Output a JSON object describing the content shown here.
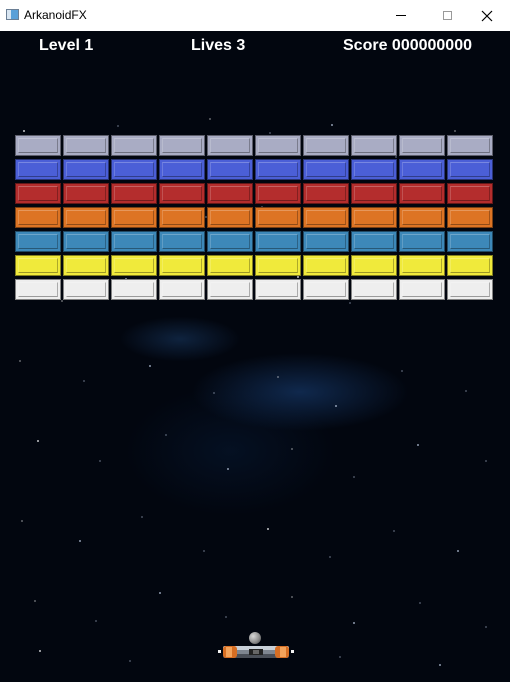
{
  "window": {
    "title": "ArkanoidFX",
    "min_icon": "minimize-icon",
    "max_icon": "maximize-icon",
    "close_icon": "close-icon"
  },
  "hud": {
    "level": "Level 1",
    "lives": "Lives 3",
    "score": "Score 000000000"
  },
  "bricks": {
    "columns": 10,
    "rows": [
      {
        "name": "silver",
        "color": "#a9acc4"
      },
      {
        "name": "blue",
        "color": "#4b5fd7"
      },
      {
        "name": "red",
        "color": "#b42d2d"
      },
      {
        "name": "orange",
        "color": "#dd7424"
      },
      {
        "name": "cyan",
        "color": "#3d88b9"
      },
      {
        "name": "yellow",
        "color": "#f0ea3b"
      },
      {
        "name": "white",
        "color": "#eeeeee"
      }
    ]
  },
  "colors": {
    "background": "#02060f",
    "hud_text": "#ffffff"
  }
}
